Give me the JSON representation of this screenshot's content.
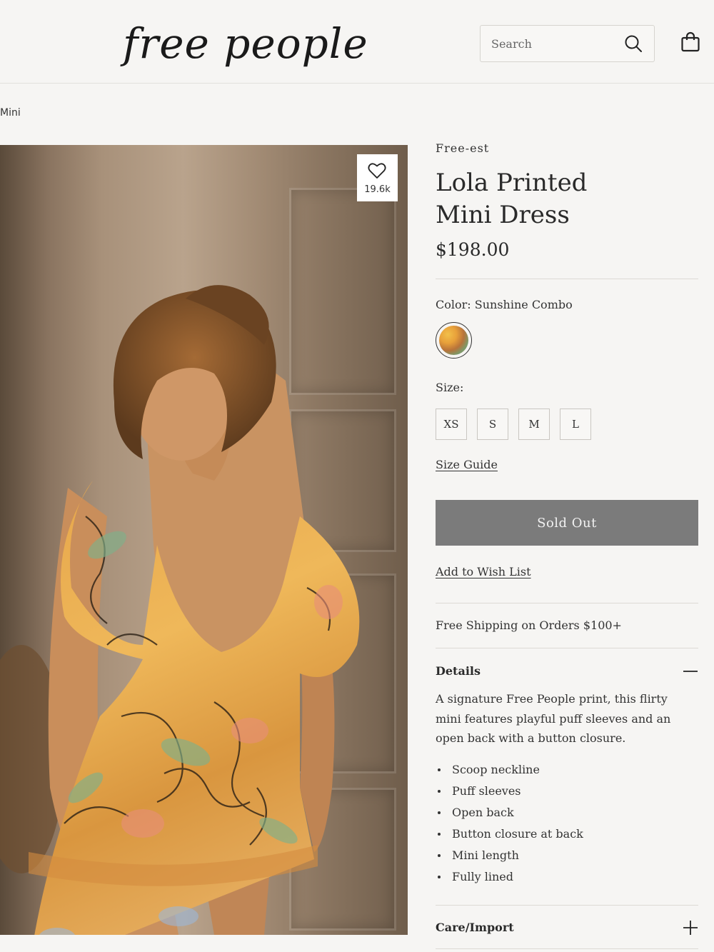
{
  "header": {
    "logo_text": "free people",
    "search_placeholder": "Search"
  },
  "breadcrumb": "Mini",
  "product": {
    "favorite_count": "19.6k",
    "brand": "Free-est",
    "title_line1": "Lola Printed",
    "title_line2": "Mini Dress",
    "price": "$198.00",
    "color_label": "Color: Sunshine Combo",
    "size_label": "Size:",
    "sizes": [
      "XS",
      "S",
      "M",
      "L"
    ],
    "size_guide": "Size Guide",
    "sold_out": "Sold Out",
    "wishlist": "Add to Wish List",
    "shipping": "Free Shipping on Orders $100+"
  },
  "details": {
    "heading": "Details",
    "description": "A signature Free People print, this flirty mini features playful puff sleeves and an open back with a button closure.",
    "bullets": [
      "Scoop neckline",
      "Puff sleeves",
      "Open back",
      "Button closure at back",
      "Mini length",
      "Fully lined"
    ]
  },
  "care": {
    "heading": "Care/Import"
  },
  "colors": {
    "sold_out_bg": "#7b7b7b",
    "page_bg": "#f6f5f3"
  }
}
